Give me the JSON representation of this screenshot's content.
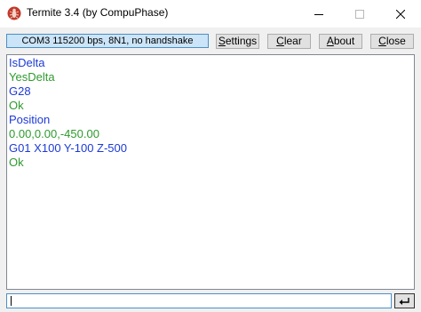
{
  "window": {
    "title": "Termite 3.4 (by CompuPhase)"
  },
  "toolbar": {
    "status": "COM3 115200 bps, 8N1, no handshake",
    "settings_first": "S",
    "settings_rest": "ettings",
    "clear_first": "C",
    "clear_rest": "lear",
    "about_first": "A",
    "about_rest": "bout",
    "close_first": "C",
    "close_rest": "lose"
  },
  "output": {
    "lines": [
      {
        "text": "IsDelta",
        "color": "#1c3ad6"
      },
      {
        "text": "YesDelta",
        "color": "#2e9a2e"
      },
      {
        "text": "G28",
        "color": "#1c3ad6"
      },
      {
        "text": "Ok",
        "color": "#2e9a2e"
      },
      {
        "text": "Position",
        "color": "#1c3ad6"
      },
      {
        "text": "0.00,0.00,-450.00",
        "color": "#2e9a2e"
      },
      {
        "text": "G01 X100 Y-100 Z-500",
        "color": "#1c3ad6"
      },
      {
        "text": "Ok",
        "color": "#2e9a2e"
      }
    ]
  },
  "input": {
    "value": ""
  },
  "icons": {
    "app": "termite-icon",
    "minimize": "minimize-icon",
    "maximize": "maximize-icon",
    "close": "close-icon",
    "send": "enter-arrow-icon"
  },
  "colors": {
    "sent": "#1c3ad6",
    "received": "#2e9a2e",
    "status_bg": "#cce4f7",
    "accent_border": "#4a90c8"
  }
}
